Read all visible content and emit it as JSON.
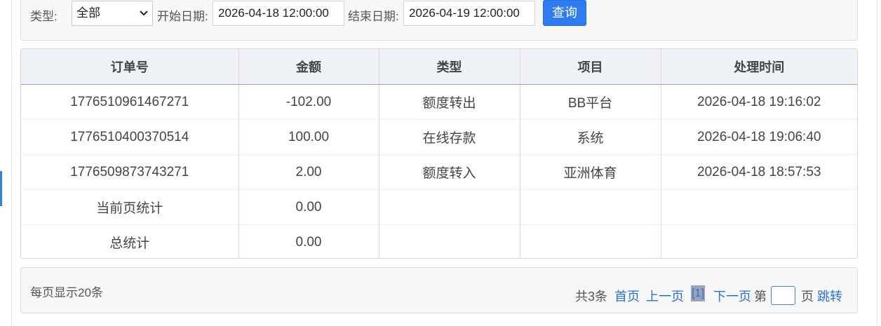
{
  "filters": {
    "type_label": "类型:",
    "type_value": "全部",
    "start_label": "开始日期:",
    "start_value": "2026-04-18 12:00:00",
    "end_label": "结束日期:",
    "end_value": "2026-04-19 12:00:00",
    "query_button": "查询"
  },
  "table": {
    "headers": [
      "订单号",
      "金额",
      "类型",
      "项目",
      "处理时间"
    ],
    "rows": [
      [
        "1776510961467271",
        "-102.00",
        "额度转出",
        "BB平台",
        "2026-04-18 19:16:02"
      ],
      [
        "1776510400370514",
        "100.00",
        "在线存款",
        "系统",
        "2026-04-18 19:06:40"
      ],
      [
        "1776509873743271",
        "2.00",
        "额度转入",
        "亚洲体育",
        "2026-04-18 18:57:53"
      ],
      [
        "当前页统计",
        "0.00",
        "",
        "",
        ""
      ],
      [
        "总统计",
        "0.00",
        "",
        "",
        ""
      ]
    ]
  },
  "pagination": {
    "per_page": "每页显示20条",
    "total": "共3条",
    "first": "首页",
    "prev": "上一页",
    "current": "[1]",
    "next": "下一页",
    "page_prefix": "第",
    "page_suffix": "页",
    "jump": "跳转"
  },
  "colors": {
    "accent": "#2e7cf0",
    "link": "#2a6fd6"
  }
}
